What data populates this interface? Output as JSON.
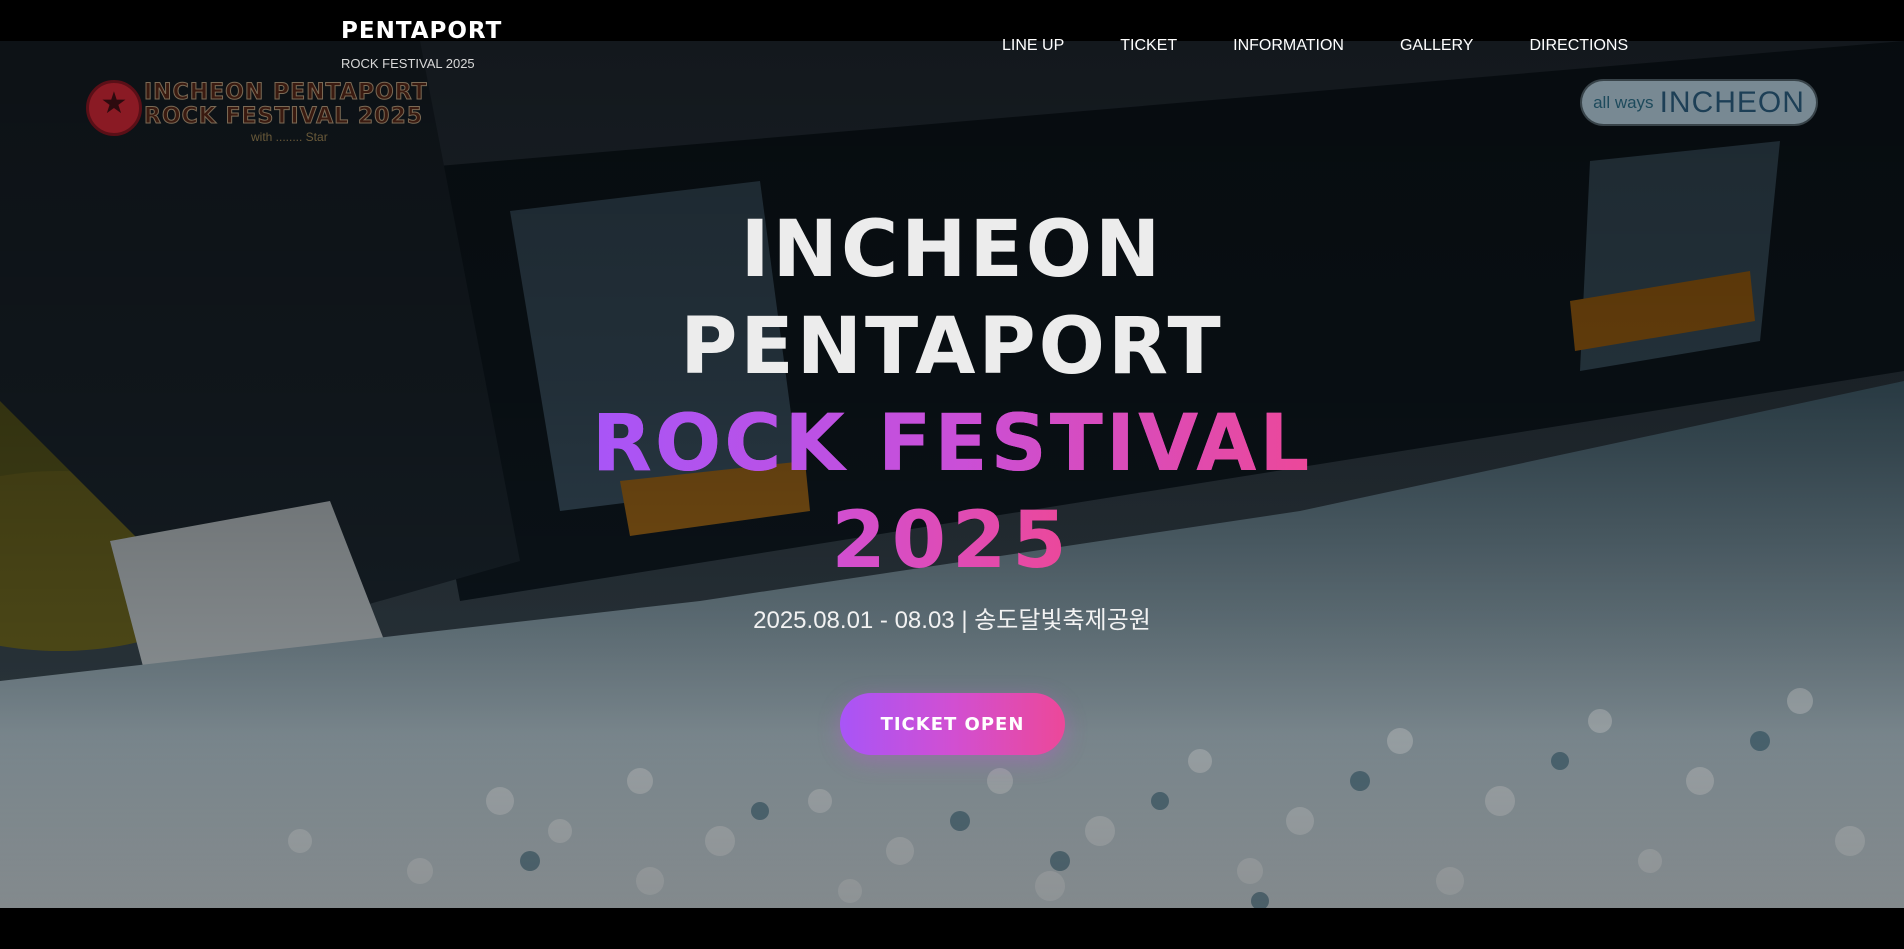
{
  "brand": {
    "title": "PENTAPORT",
    "subtitle": "ROCK FESTIVAL 2025"
  },
  "nav": {
    "items": [
      {
        "label": "LINE UP"
      },
      {
        "label": "TICKET"
      },
      {
        "label": "INFORMATION"
      },
      {
        "label": "GALLERY"
      },
      {
        "label": "DIRECTIONS"
      }
    ]
  },
  "festival_logo": {
    "line1": "INCHEON PENTAPORT",
    "line2": "ROCK FESTIVAL 2025",
    "line3": "with ........ Star",
    "icon": "star-icon"
  },
  "partner_logo": {
    "small": "all ways",
    "big": "INCHEON"
  },
  "hero": {
    "line1": "INCHEON",
    "line2": "PENTAPORT",
    "line3": "ROCK FESTIVAL",
    "line4": "2025",
    "date_venue": "2025.08.01 - 08.03 | 송도달빛축제공원",
    "cta_label": "TICKET OPEN"
  },
  "colors": {
    "gradient_start": "#a855f7",
    "gradient_end": "#ec4899",
    "background": "#000000",
    "text": "#ececec"
  }
}
